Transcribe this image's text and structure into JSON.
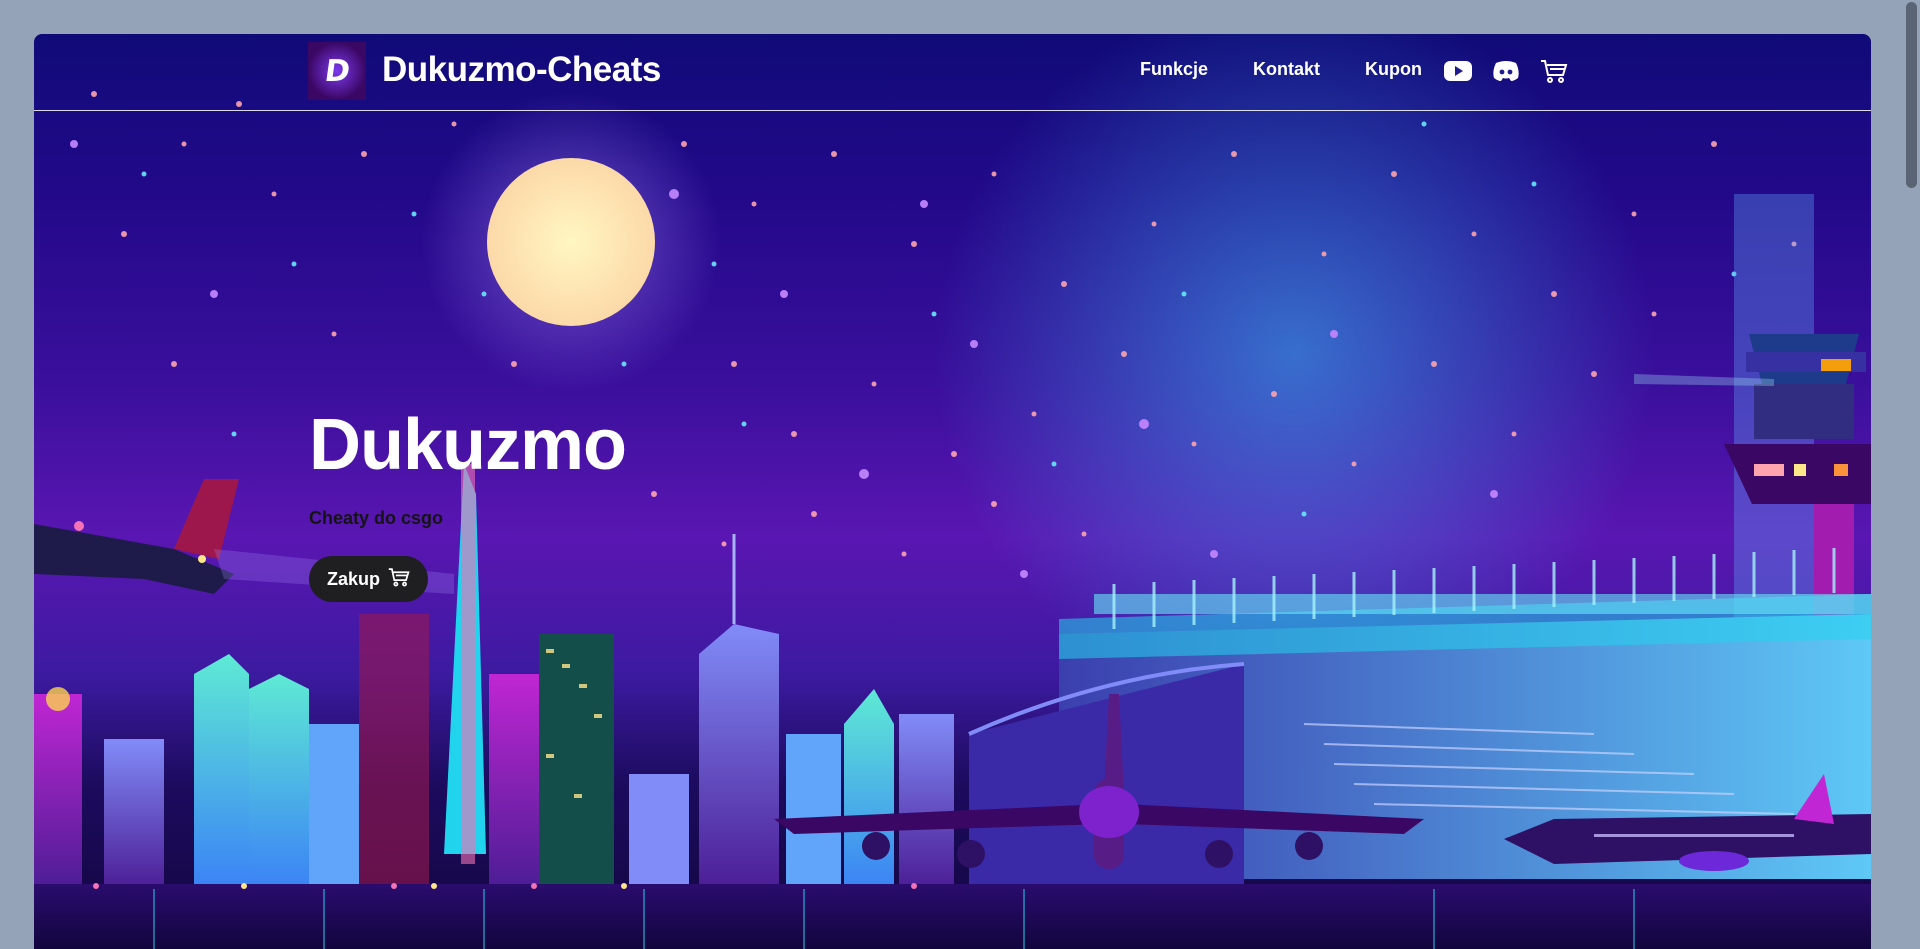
{
  "brand": {
    "logo_letter": "D",
    "name": "Dukuzmo-Cheats"
  },
  "nav": {
    "links": [
      {
        "label": "Funkcje"
      },
      {
        "label": "Kontakt"
      },
      {
        "label": "Kupon"
      }
    ],
    "icons": [
      "youtube-icon",
      "discord-icon",
      "cart-icon"
    ]
  },
  "hero": {
    "title": "Dukuzmo",
    "subtitle": "Cheaty do csgo",
    "cta_label": "Zakup",
    "cta_icon": "cart-icon"
  },
  "colors": {
    "sky_top": "#100a78",
    "sky_mid": "#5a16b2",
    "moon": "#fde68a",
    "neon_cyan": "#22d3ee",
    "neon_pink": "#e879f9",
    "button_bg": "#1f1f22"
  }
}
